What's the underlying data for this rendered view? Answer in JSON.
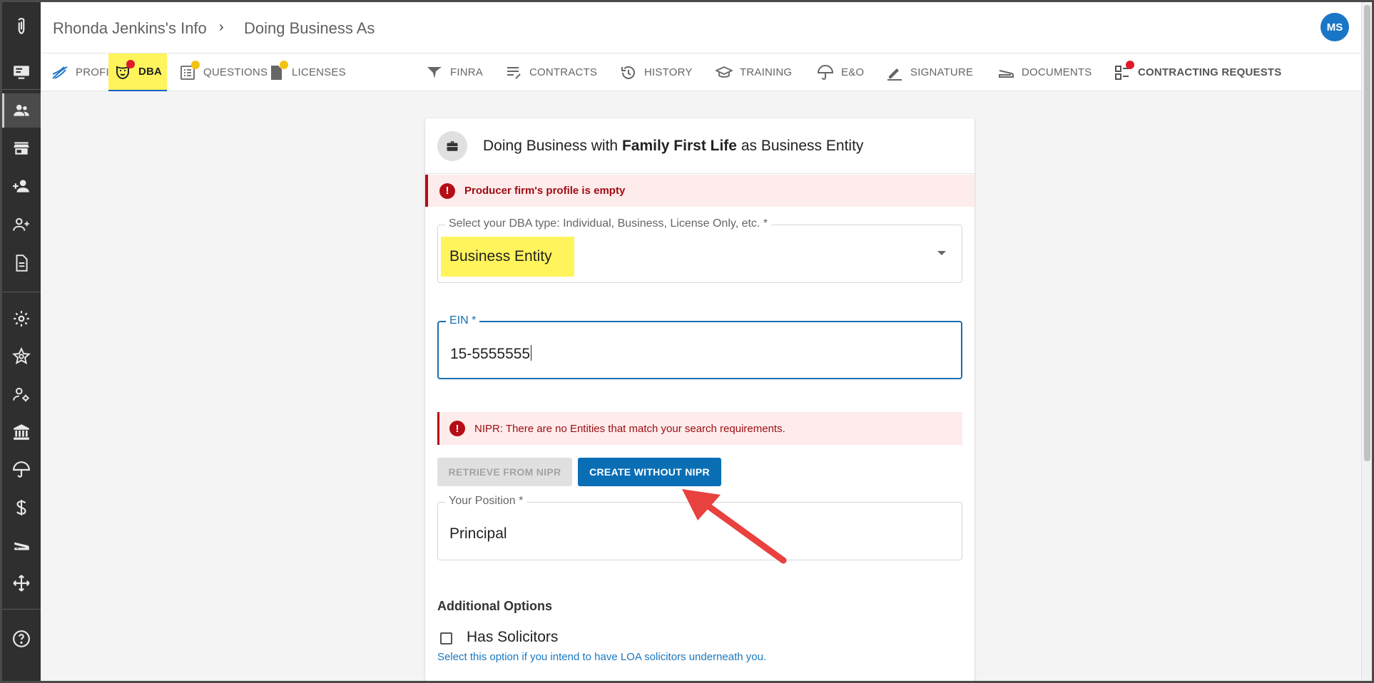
{
  "header": {
    "breadcrumb_parent": "Rhonda Jenkins's Info",
    "breadcrumb_separator": "›",
    "breadcrumb_current": "Doing Business As",
    "avatar_initials": "MS"
  },
  "tabs": [
    {
      "label": "PROFILE",
      "icon": "profile-swoosh-icon"
    },
    {
      "label": "DBA",
      "icon": "dba-mask-icon",
      "active": true,
      "badge": "red"
    },
    {
      "label": "QUESTIONS",
      "icon": "questions-list-icon",
      "badge": "yellow"
    },
    {
      "label": "LICENSES",
      "icon": "licenses-doc-icon",
      "badge": "yellow"
    },
    {
      "label": "FINRA",
      "icon": "finra-icon"
    },
    {
      "label": "CONTRACTS",
      "icon": "contracts-icon"
    },
    {
      "label": "HISTORY",
      "icon": "history-icon"
    },
    {
      "label": "TRAINING",
      "icon": "training-cap-icon"
    },
    {
      "label": "E&O",
      "icon": "umbrella-icon"
    },
    {
      "label": "SIGNATURE",
      "icon": "signature-pen-icon"
    },
    {
      "label": "DOCUMENTS",
      "icon": "documents-icon"
    },
    {
      "label": "CONTRACTING REQUESTS",
      "icon": "contracting-requests-icon",
      "badge": "red"
    }
  ],
  "card": {
    "title_prefix": "Doing Business with ",
    "title_company": "Family First Life",
    "title_suffix": " as Business Entity",
    "profile_alert": "Producer firm's profile is empty",
    "dba_type_label": "Select your DBA type: Individual, Business, License Only, etc. *",
    "dba_type_value": "Business Entity",
    "ein_label": "EIN *",
    "ein_value": "15-5555555",
    "nipr_alert": "NIPR: There are no Entities that match your search requirements.",
    "retrieve_button": "RETRIEVE FROM NIPR",
    "create_button": "CREATE WITHOUT NIPR",
    "position_label": "Your Position *",
    "position_value": "Principal",
    "additional_options_heading": "Additional Options",
    "has_solicitors_label": "Has Solicitors",
    "has_solicitors_help": "Select this option if you intend to have LOA solicitors underneath you."
  },
  "colors": {
    "highlight": "#fff45c",
    "primary": "#0a6eb5",
    "error": "#b40d16",
    "rail": "#2f2f2f",
    "annotation_arrow": "#e8413e"
  }
}
